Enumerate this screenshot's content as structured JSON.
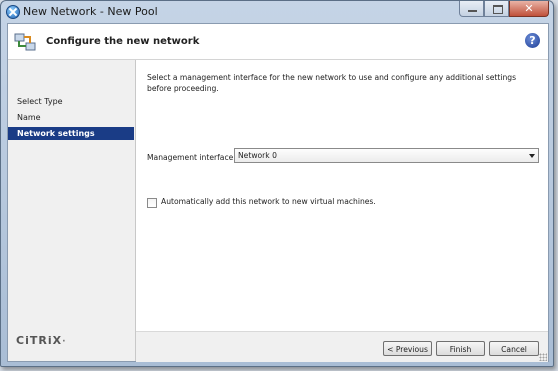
{
  "window": {
    "title": "New Network - New Pool",
    "icon": "xencenter-icon"
  },
  "header": {
    "title": "Configure the new network",
    "icon": "network-wizard-icon",
    "help_icon": "help-icon",
    "help_glyph": "?"
  },
  "sidebar": {
    "items": [
      {
        "label": "Select Type",
        "active": false
      },
      {
        "label": "Name",
        "active": false
      },
      {
        "label": "Network settings",
        "active": true
      }
    ],
    "logo_text": "CiTRiX",
    "logo_mark": "·"
  },
  "content": {
    "instructions": "Select a management interface for the new network to use and configure any additional settings before proceeding.",
    "management_interface": {
      "label": "Management interface:",
      "selected": "Network 0"
    },
    "auto_add": {
      "label": "Automatically add this network to new virtual machines.",
      "checked": false
    }
  },
  "footer": {
    "previous_label": "< Previous",
    "finish_label": "Finish",
    "cancel_label": "Cancel"
  },
  "colors": {
    "active_nav_bg": "#1a3c86",
    "help_icon_bg": "#1b3b94"
  }
}
